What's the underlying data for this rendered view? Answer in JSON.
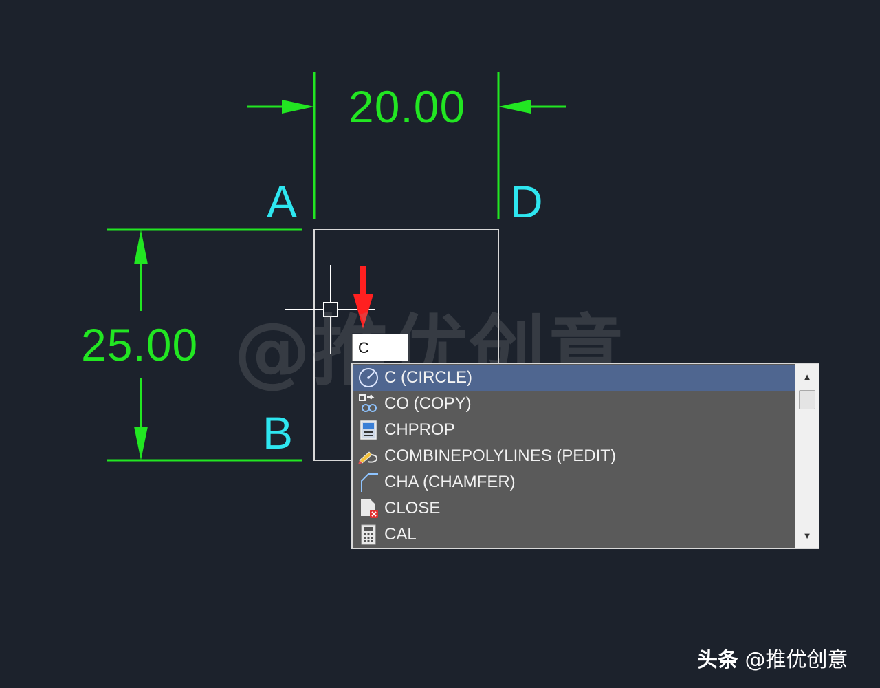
{
  "drawing": {
    "dim_horizontal": "20.00",
    "dim_vertical": "25.00",
    "point_a": "A",
    "point_b": "B",
    "point_d": "D",
    "colors": {
      "dimension": "#22e622",
      "point_label": "#2ee6f0",
      "geometry": "#d8d8d8",
      "arrow": "#ff2020"
    }
  },
  "watermark_text": "@推优创意",
  "command": {
    "input_value": "C"
  },
  "autocomplete": {
    "items": [
      {
        "label": "C (CIRCLE)",
        "icon": "circle-icon",
        "selected": true
      },
      {
        "label": "CO (COPY)",
        "icon": "copy-icon",
        "selected": false
      },
      {
        "label": "CHPROP",
        "icon": "properties-icon",
        "selected": false
      },
      {
        "label": "COMBINEPOLYLINES (PEDIT)",
        "icon": "pencil-icon",
        "selected": false
      },
      {
        "label": "CHA (CHAMFER)",
        "icon": "chamfer-icon",
        "selected": false
      },
      {
        "label": "CLOSE",
        "icon": "close-document-icon",
        "selected": false
      },
      {
        "label": "CAL",
        "icon": "calculator-icon",
        "selected": false
      }
    ]
  },
  "footer": {
    "brand": "头条",
    "handle": "@推优创意"
  }
}
